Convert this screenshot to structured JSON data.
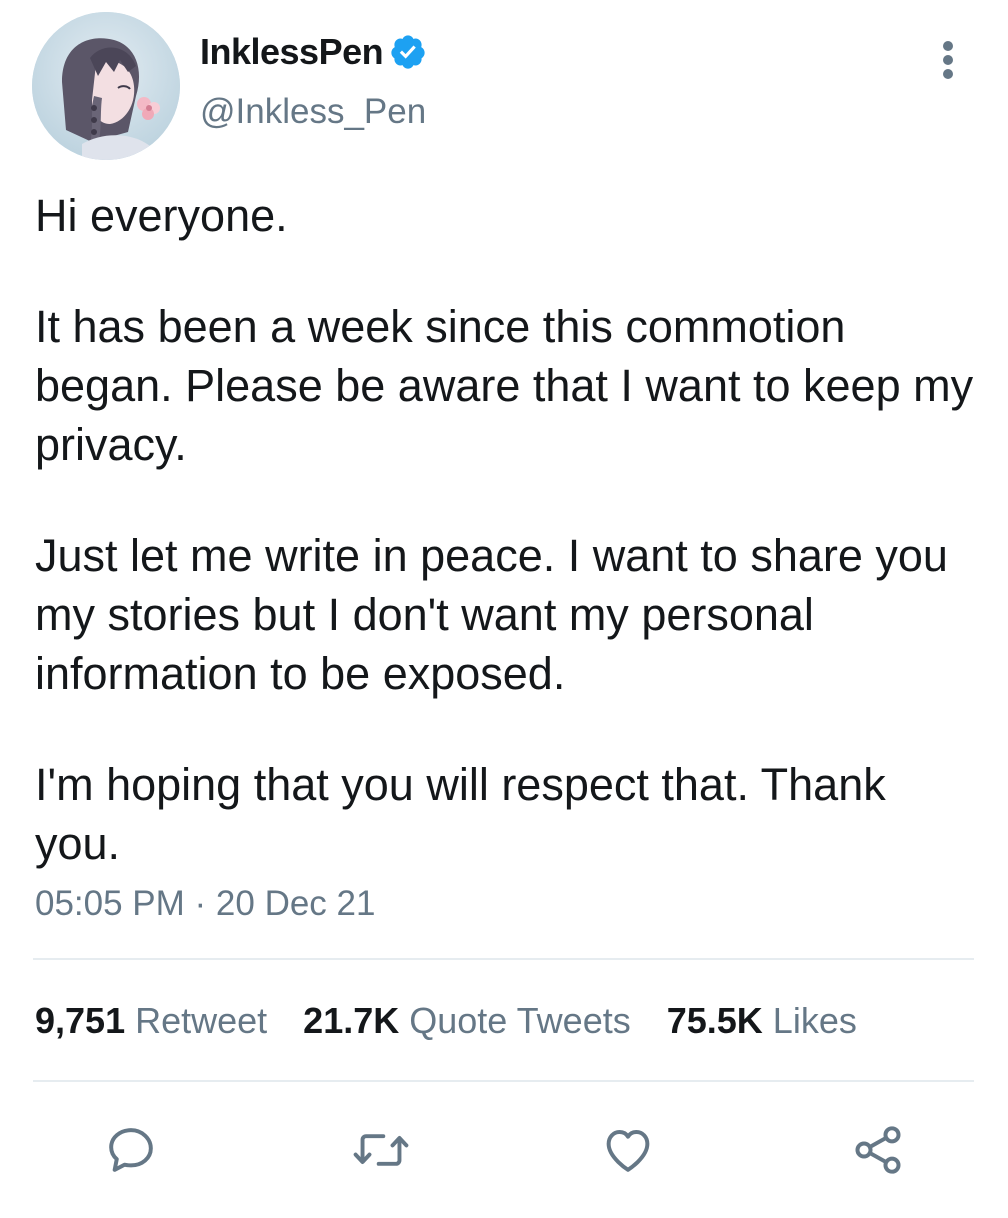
{
  "user": {
    "display_name": "InklessPen",
    "handle": "@Inkless_Pen",
    "verified": true,
    "avatar_icon": "anime-girl-avatar"
  },
  "tweet": {
    "paragraphs": [
      "Hi everyone.",
      "It has been a week since this commotion began. Please be aware that I want to keep my privacy.",
      "Just let me write in peace. I want to share you my stories but I don't want my personal information to be exposed.",
      "I'm hoping that you will respect that. Thank you."
    ],
    "timestamp": "05:05 PM · 20 Dec 21"
  },
  "stats": {
    "retweets_count": "9,751",
    "retweets_label": "Retweet",
    "quotes_count": "21.7K",
    "quotes_label": "Quote Tweets",
    "likes_count": "75.5K",
    "likes_label": "Likes"
  },
  "actions": [
    {
      "name": "reply",
      "icon": "comment-icon"
    },
    {
      "name": "retweet",
      "icon": "retweet-icon"
    },
    {
      "name": "like",
      "icon": "heart-icon"
    },
    {
      "name": "share",
      "icon": "share-icon"
    }
  ],
  "colors": {
    "text": "#14171a",
    "secondary": "#657786",
    "verified": "#1da1f2",
    "divider": "#e6ecf0"
  }
}
